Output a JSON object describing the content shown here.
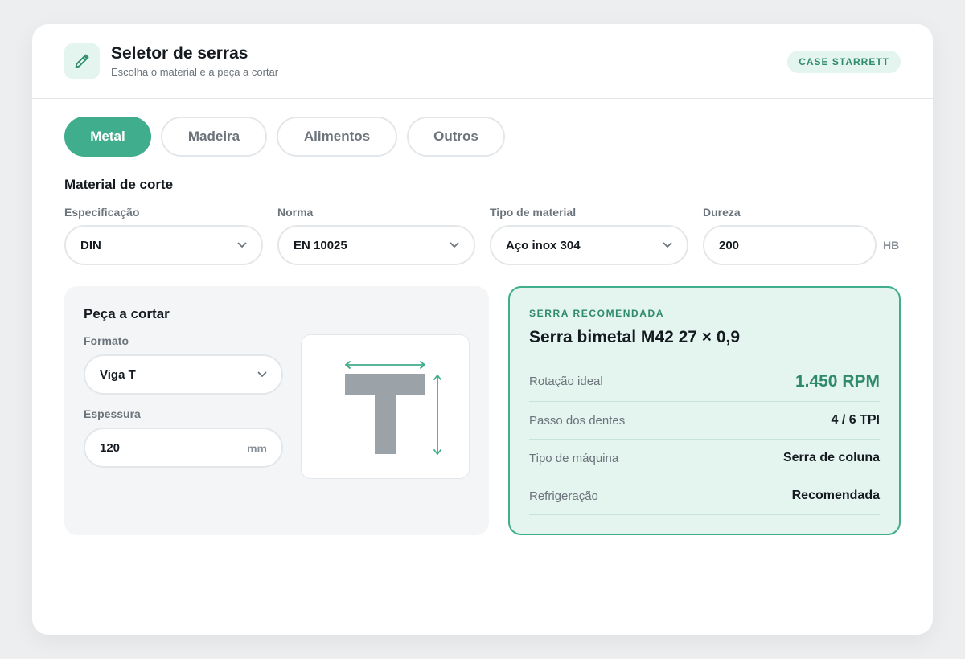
{
  "header": {
    "title": "Seletor de serras",
    "subtitle": "Escolha o material e a peça a cortar",
    "badge": "CASE STARRETT",
    "icon": "pencil-icon"
  },
  "tabs": [
    {
      "label": "Metal",
      "active": true
    },
    {
      "label": "Madeira",
      "active": false
    },
    {
      "label": "Alimentos",
      "active": false
    },
    {
      "label": "Outros",
      "active": false
    }
  ],
  "material": {
    "section_title": "Material de corte",
    "especificacao": {
      "label": "Especificação",
      "value": "DIN"
    },
    "norma": {
      "label": "Norma",
      "value": "EN 10025"
    },
    "tipo": {
      "label": "Tipo de material",
      "value": "Aço inox 304"
    },
    "dureza": {
      "label": "Dureza",
      "value": "200",
      "unit": "HB"
    }
  },
  "piece": {
    "title": "Peça a cortar",
    "formato": {
      "label": "Formato",
      "value": "Viga T"
    },
    "espessura": {
      "label": "Espessura",
      "value": "120",
      "unit": "mm"
    },
    "shape_icon": "t-beam-icon"
  },
  "recommendation": {
    "eyebrow": "SERRA RECOMENDADA",
    "title": "Serra bimetal M42 27 × 0,9",
    "rows": [
      {
        "label": "Rotação ideal",
        "value": "1.450 RPM"
      },
      {
        "label": "Passo dos dentes",
        "value": "4 / 6 TPI"
      },
      {
        "label": "Tipo de máquina",
        "value": "Serra de coluna"
      },
      {
        "label": "Refrigeração",
        "value": "Recomendada"
      }
    ]
  },
  "colors": {
    "accent": "#40ad8c",
    "accent_dark": "#2e8a6b",
    "accent_light": "#e4f4ef",
    "shape_gray": "#9ca3a8"
  }
}
